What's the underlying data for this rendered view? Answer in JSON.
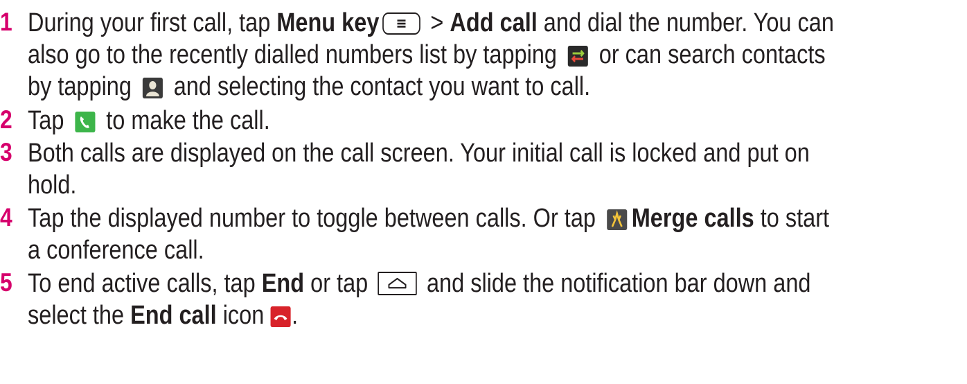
{
  "steps": [
    {
      "number": "1",
      "lines": [
        {
          "a": "During your first call, tap ",
          "b1": "Menu key",
          "c": " > ",
          "b2": "Add call",
          "d": " and dial the number. You can"
        },
        {
          "a": "also go to the recently dialled numbers list by tapping ",
          "b": " or can search contacts"
        },
        {
          "a": "by tapping ",
          "b": " and selecting the contact you want to call."
        }
      ]
    },
    {
      "number": "2",
      "lines": [
        {
          "a": "Tap ",
          "b": " to make the call."
        }
      ]
    },
    {
      "number": "3",
      "lines": [
        {
          "a": "Both calls are displayed on the call screen. Your initial call is locked and put on"
        },
        {
          "a": "hold."
        }
      ]
    },
    {
      "number": "4",
      "lines": [
        {
          "a": "Tap the displayed number to toggle between calls. Or tap ",
          "b1": "Merge calls",
          "c": " to start"
        },
        {
          "a": "a conference call."
        }
      ]
    },
    {
      "number": "5",
      "lines": [
        {
          "a": "To end active calls, tap ",
          "b1": "End",
          "c": " or tap ",
          "d": " and slide the notification bar down and"
        },
        {
          "a": "select the ",
          "b1": "End call",
          "c": " icon ",
          "d": "."
        }
      ]
    }
  ],
  "icons": {
    "menu_key": "menu-key-icon",
    "recent_calls": "swap-arrows-icon",
    "contacts": "contact-icon",
    "call": "phone-call-icon",
    "merge": "merge-calls-icon",
    "home_key": "home-key-icon",
    "end_call": "end-call-icon"
  },
  "colors": {
    "step_number": "#d6006c",
    "text": "#231f20",
    "call_green": "#3db54a",
    "end_red": "#d8232a"
  }
}
